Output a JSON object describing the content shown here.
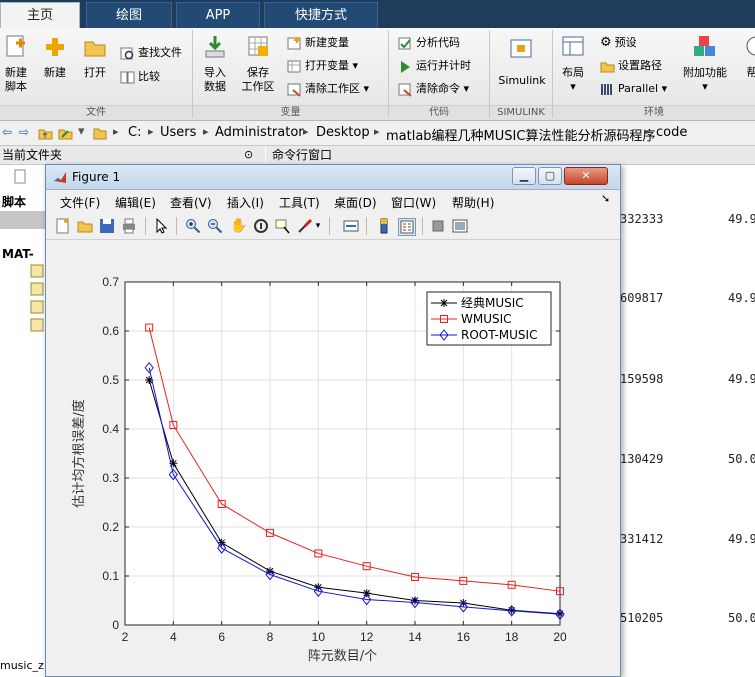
{
  "tabs": [
    {
      "label": "主页"
    },
    {
      "label": "绘图"
    },
    {
      "label": "APP"
    },
    {
      "label": "快捷方式"
    }
  ],
  "ribbon": {
    "new_script": "新建\n脚本",
    "new_script_l1": "新建",
    "new_script_l2": "脚本",
    "new": "新建",
    "open": "打开",
    "find_files": "查找文件",
    "compare": "比较",
    "import_l1": "导入",
    "import_l2": "数据",
    "save_l1": "保存",
    "save_l2": "工作区",
    "new_variable": "新建变量",
    "open_variable": "打开变量",
    "clear_workspace": "清除工作区",
    "analyze_code": "分析代码",
    "run_and_time": "运行并计时",
    "clear_commands": "清除命令",
    "simulink": "Simulink",
    "layout": "布局",
    "preferences": "预设",
    "set_path": "设置路径",
    "parallel": "Parallel",
    "addons": "附加功能",
    "help_partial": "帮",
    "groups": {
      "file": "文件",
      "variable": "变量",
      "code": "代码",
      "simulink": "SIMULINK",
      "environment": "环境"
    }
  },
  "address": {
    "crumbs": [
      "C:",
      "Users",
      "Administrator",
      "Desktop",
      "matlab编程几种MUSIC算法性能分析源码程序",
      "code"
    ]
  },
  "panes": {
    "current_folder": "当前文件夹",
    "command_window": "命令行窗口",
    "left_items": [
      "脚本",
      "MAT-",
      "music_z"
    ]
  },
  "command_values": [
    {
      "a": "332333",
      "b": "49.9"
    },
    {
      "a": "609817",
      "b": "49.9"
    },
    {
      "a": "159598",
      "b": "49.9"
    },
    {
      "a": "130429",
      "b": "50.0"
    },
    {
      "a": "331412",
      "b": "49.9"
    },
    {
      "a": "510205",
      "b": "50.0"
    }
  ],
  "figure": {
    "title": "Figure 1",
    "menu": [
      "文件(F)",
      "编辑(E)",
      "查看(V)",
      "插入(I)",
      "工具(T)",
      "桌面(D)",
      "窗口(W)",
      "帮助(H)"
    ]
  },
  "colors": {
    "tabbar": "#1f3c5d",
    "series1": "#000000",
    "series2": "#e8201c",
    "series3": "#1515d6"
  },
  "chart_data": {
    "type": "line",
    "xlabel": "阵元数目/个",
    "ylabel": "估计均方根误差/度",
    "xlim": [
      2,
      20
    ],
    "ylim": [
      0,
      0.7
    ],
    "xticks": [
      2,
      4,
      6,
      8,
      10,
      12,
      14,
      16,
      18,
      20
    ],
    "yticks": [
      0,
      0.1,
      0.2,
      0.3,
      0.4,
      0.5,
      0.6,
      0.7
    ],
    "grid": true,
    "legend_position": "top-right",
    "x": [
      3,
      4,
      6,
      8,
      10,
      12,
      14,
      16,
      18,
      20
    ],
    "series": [
      {
        "name": "经典MUSIC",
        "color": "#000000",
        "marker": "star",
        "values": [
          0.5,
          0.33,
          0.168,
          0.11,
          0.077,
          0.065,
          0.05,
          0.045,
          0.03,
          0.023
        ]
      },
      {
        "name": "WMUSIC",
        "color": "#e8201c",
        "marker": "square",
        "values": [
          0.607,
          0.408,
          0.247,
          0.188,
          0.146,
          0.12,
          0.098,
          0.09,
          0.082,
          0.069
        ]
      },
      {
        "name": "ROOT-MUSIC",
        "color": "#1515d6",
        "marker": "diamond",
        "values": [
          0.525,
          0.307,
          0.157,
          0.103,
          0.069,
          0.052,
          0.046,
          0.037,
          0.029,
          0.022
        ]
      }
    ]
  }
}
